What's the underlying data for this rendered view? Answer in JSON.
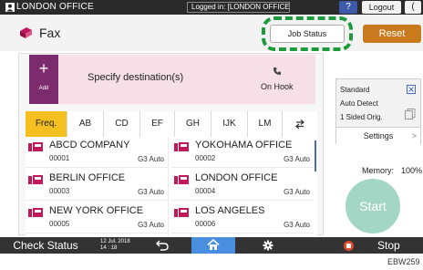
{
  "topbar": {
    "office_name": "LONDON OFFICE",
    "logged_in": "Logged in: [LONDON OFFICE]",
    "help_label": "?",
    "logout_label": "Logout",
    "power_label": "("
  },
  "header": {
    "title": "Fax",
    "job_status_label": "Job Status",
    "reset_label": "Reset"
  },
  "destination": {
    "add_plus": "+",
    "add_label": "Add",
    "prompt": "Specify destination(s)",
    "on_hook_label": "On Hook"
  },
  "tabs": [
    {
      "label": "Freq."
    },
    {
      "label": "AB"
    },
    {
      "label": "CD"
    },
    {
      "label": "EF"
    },
    {
      "label": "GH"
    },
    {
      "label": "IJK"
    },
    {
      "label": "LM"
    }
  ],
  "tab_swap_icon": "swap-arrows-icon",
  "entries": [
    {
      "name": "ABCD COMPANY",
      "number": "00001",
      "mode": "G3 Auto"
    },
    {
      "name": "YOKOHAMA OFFICE",
      "number": "00002",
      "mode": "G3 Auto"
    },
    {
      "name": "BERLIN OFFICE",
      "number": "00003",
      "mode": "G3 Auto"
    },
    {
      "name": "LONDON OFFICE",
      "number": "00004",
      "mode": "G3 Auto"
    },
    {
      "name": "NEW YORK OFFICE",
      "number": "00005",
      "mode": "G3 Auto"
    },
    {
      "name": "LOS ANGELES",
      "number": "00006",
      "mode": "G3 Auto"
    }
  ],
  "settings": {
    "line1": "Standard",
    "line2": "Auto Detect",
    "line3": "1 Sided Orig.",
    "button_label": "Settings",
    "chevron": ">"
  },
  "memory": {
    "label": "Memory:",
    "value": "100%"
  },
  "start_label": "Start",
  "bottombar": {
    "check_status_label": "Check Status",
    "date": "12 Jul. 2018",
    "time": "14 : 18",
    "stop_label": "Stop"
  },
  "footer_code": "EBW259",
  "colors": {
    "add_button": "#7d2b6f",
    "destination_bg": "#f6dfe6",
    "active_tab": "#f4c020",
    "reset_button": "#c97a1e",
    "start_button": "#a3d6c4",
    "home_button": "#4a8ee0",
    "highlight": "#1c9a3c",
    "fax_icon": "#c2185b"
  }
}
